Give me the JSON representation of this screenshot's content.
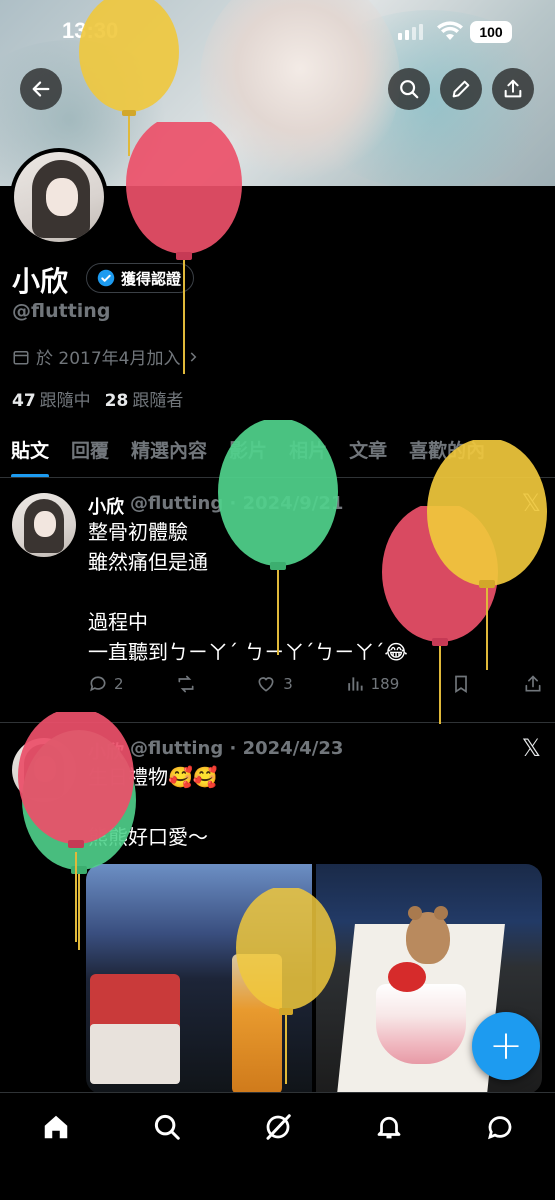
{
  "status": {
    "time": "13:30",
    "battery": "100"
  },
  "profile": {
    "name": "小欣",
    "verified_label": "獲得認證",
    "handle": "@flutting",
    "joined": "於 2017年4月加入",
    "following_count": "47",
    "following_label": "跟隨中",
    "followers_count": "28",
    "followers_label": "跟隨者"
  },
  "tabs": [
    "貼文",
    "回覆",
    "精選內容",
    "影片",
    "相片",
    "文章",
    "喜歡的內"
  ],
  "tweets": [
    {
      "name": "小欣",
      "meta": "@flutting · 2024/9/21",
      "text": "整骨初體驗\n雖然痛但是通\n\n過程中\n一直聽到ㄅㄧㄚˊ ㄅㄧㄚˊㄅㄧㄚˊ😂",
      "replies": "2",
      "retweets": "",
      "likes": "3",
      "views": "189"
    },
    {
      "name": "小欣",
      "meta": "@flutting · 2024/4/23",
      "text": "生日禮物🥰🥰\n\n熊熊好口愛～"
    }
  ],
  "icons": {
    "back": "back-arrow-icon",
    "search": "search-icon",
    "edit": "pencil-icon",
    "share": "share-icon",
    "calendar": "calendar-icon",
    "verified": "verified-badge-icon",
    "x_logo": "x-logo-icon",
    "fab": "plus-icon"
  },
  "colors": {
    "accent": "#1d9bf0",
    "muted": "#71767b",
    "background": "#000000"
  }
}
